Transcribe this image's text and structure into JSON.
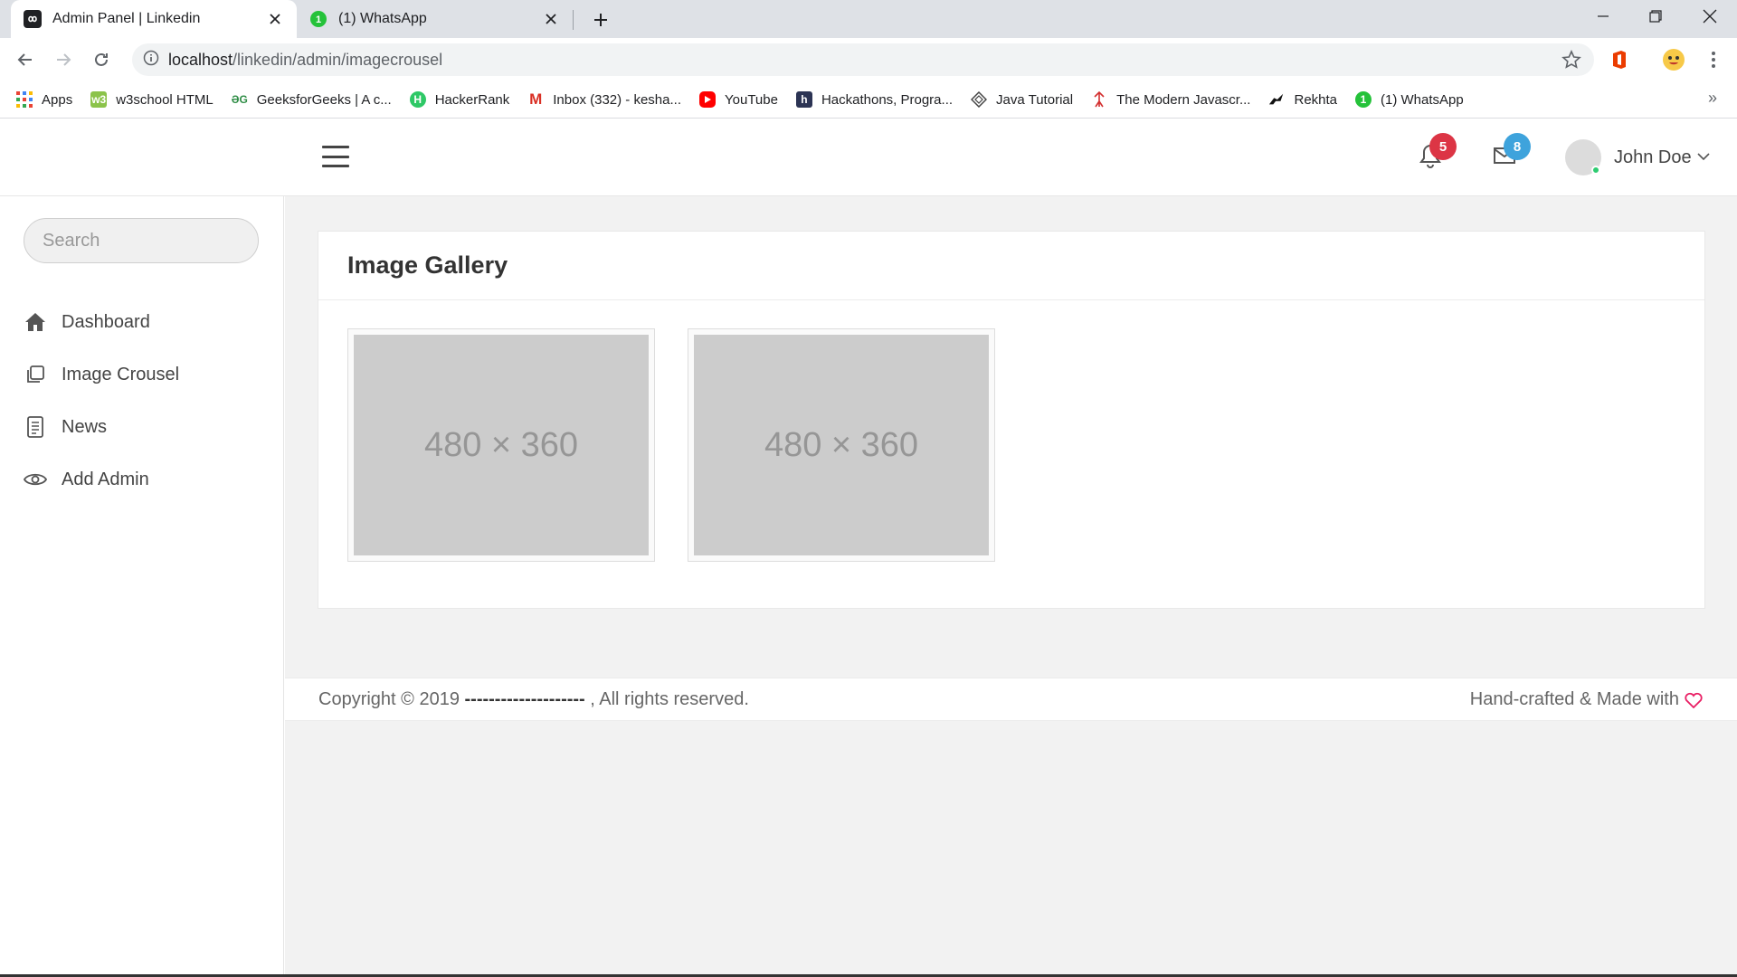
{
  "browser": {
    "tabs": [
      {
        "title": "Admin Panel | Linkedin",
        "active": true,
        "favicon": "infinity-icon"
      },
      {
        "title": "(1) WhatsApp",
        "active": false,
        "favicon": "whatsapp-icon"
      }
    ],
    "url_host": "localhost",
    "url_path": "/linkedin/admin/imagecrousel",
    "bookmarks": [
      {
        "label": "Apps",
        "icon": "apps-grid-icon"
      },
      {
        "label": "w3school HTML",
        "icon": "w3schools-icon"
      },
      {
        "label": "GeeksforGeeks | A c...",
        "icon": "geeksforgeeks-icon"
      },
      {
        "label": "HackerRank",
        "icon": "hackerrank-icon"
      },
      {
        "label": "Inbox (332) - kesha...",
        "icon": "gmail-icon"
      },
      {
        "label": "YouTube",
        "icon": "youtube-icon"
      },
      {
        "label": "Hackathons, Progra...",
        "icon": "hackerearth-icon"
      },
      {
        "label": "Java Tutorial",
        "icon": "java-tutorial-icon"
      },
      {
        "label": "The Modern Javascr...",
        "icon": "javascript-info-icon"
      },
      {
        "label": "Rekhta",
        "icon": "rekhta-icon"
      },
      {
        "label": "(1) WhatsApp",
        "icon": "whatsapp-icon"
      }
    ],
    "bookmarks_more": "»"
  },
  "header": {
    "notifications_count": "5",
    "messages_count": "8",
    "user_name": "John Doe",
    "colors": {
      "notif_badge": "#dc3545",
      "msg_badge": "#3ea3dc"
    }
  },
  "sidebar": {
    "search_placeholder": "Search",
    "items": [
      {
        "label": "Dashboard",
        "icon": "home-icon"
      },
      {
        "label": "Image Crousel",
        "icon": "copy-icon"
      },
      {
        "label": "News",
        "icon": "document-icon"
      },
      {
        "label": "Add Admin",
        "icon": "eye-icon"
      }
    ]
  },
  "main": {
    "title": "Image Gallery",
    "images": [
      {
        "placeholder": "480 × 360"
      },
      {
        "placeholder": "480 × 360"
      }
    ]
  },
  "footer": {
    "copyright_prefix": "Copyright © 2019",
    "owner": "--------------------",
    "copyright_suffix": ", All rights reserved.",
    "credit": "Hand-crafted & Made with",
    "heart_color": "#e91e63"
  }
}
